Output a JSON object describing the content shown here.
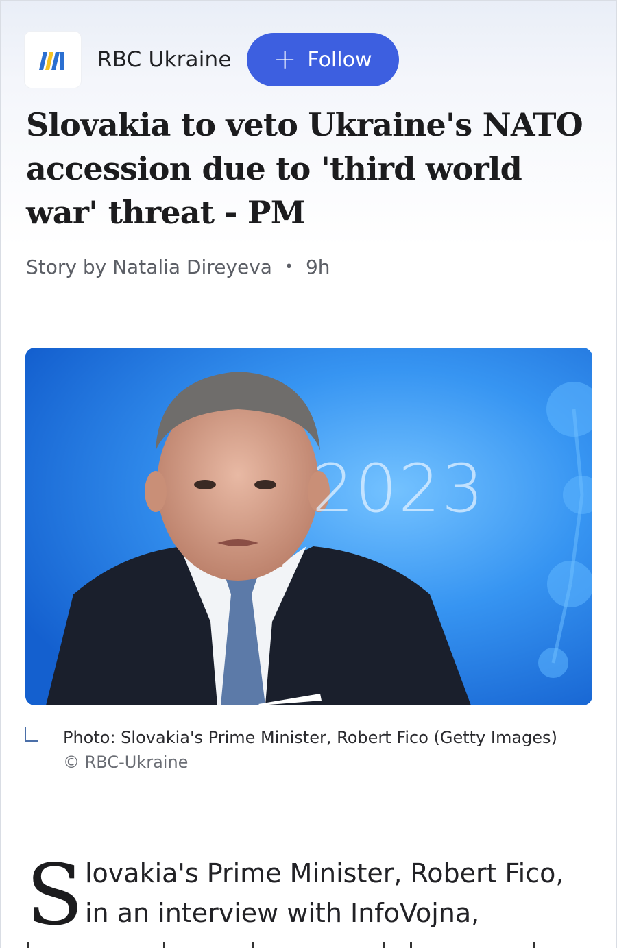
{
  "header": {
    "publisher": "RBC Ukraine",
    "follow_label": "Follow",
    "logo_icon": "rbc-ukraine-logo-icon"
  },
  "article": {
    "title": "Slovakia to veto Ukraine's NATO accession due to 'third world war' threat - PM",
    "byline": "Story by Natalia Direyeva",
    "age": "9h",
    "image_overlay_text": "2023",
    "caption": "Photo: Slovakia's Prime Minister, Robert Fico (Getty Images)",
    "credit": "© RBC-Ukraine",
    "dropcap": "S",
    "lead_text": "lovakia's Prime Minister, Robert Fico, in an interview with InfoVojna,"
  },
  "colors": {
    "accent": "#3d5fe0",
    "hero_blue": "#2f8cf0",
    "text": "#1c1c1e"
  }
}
